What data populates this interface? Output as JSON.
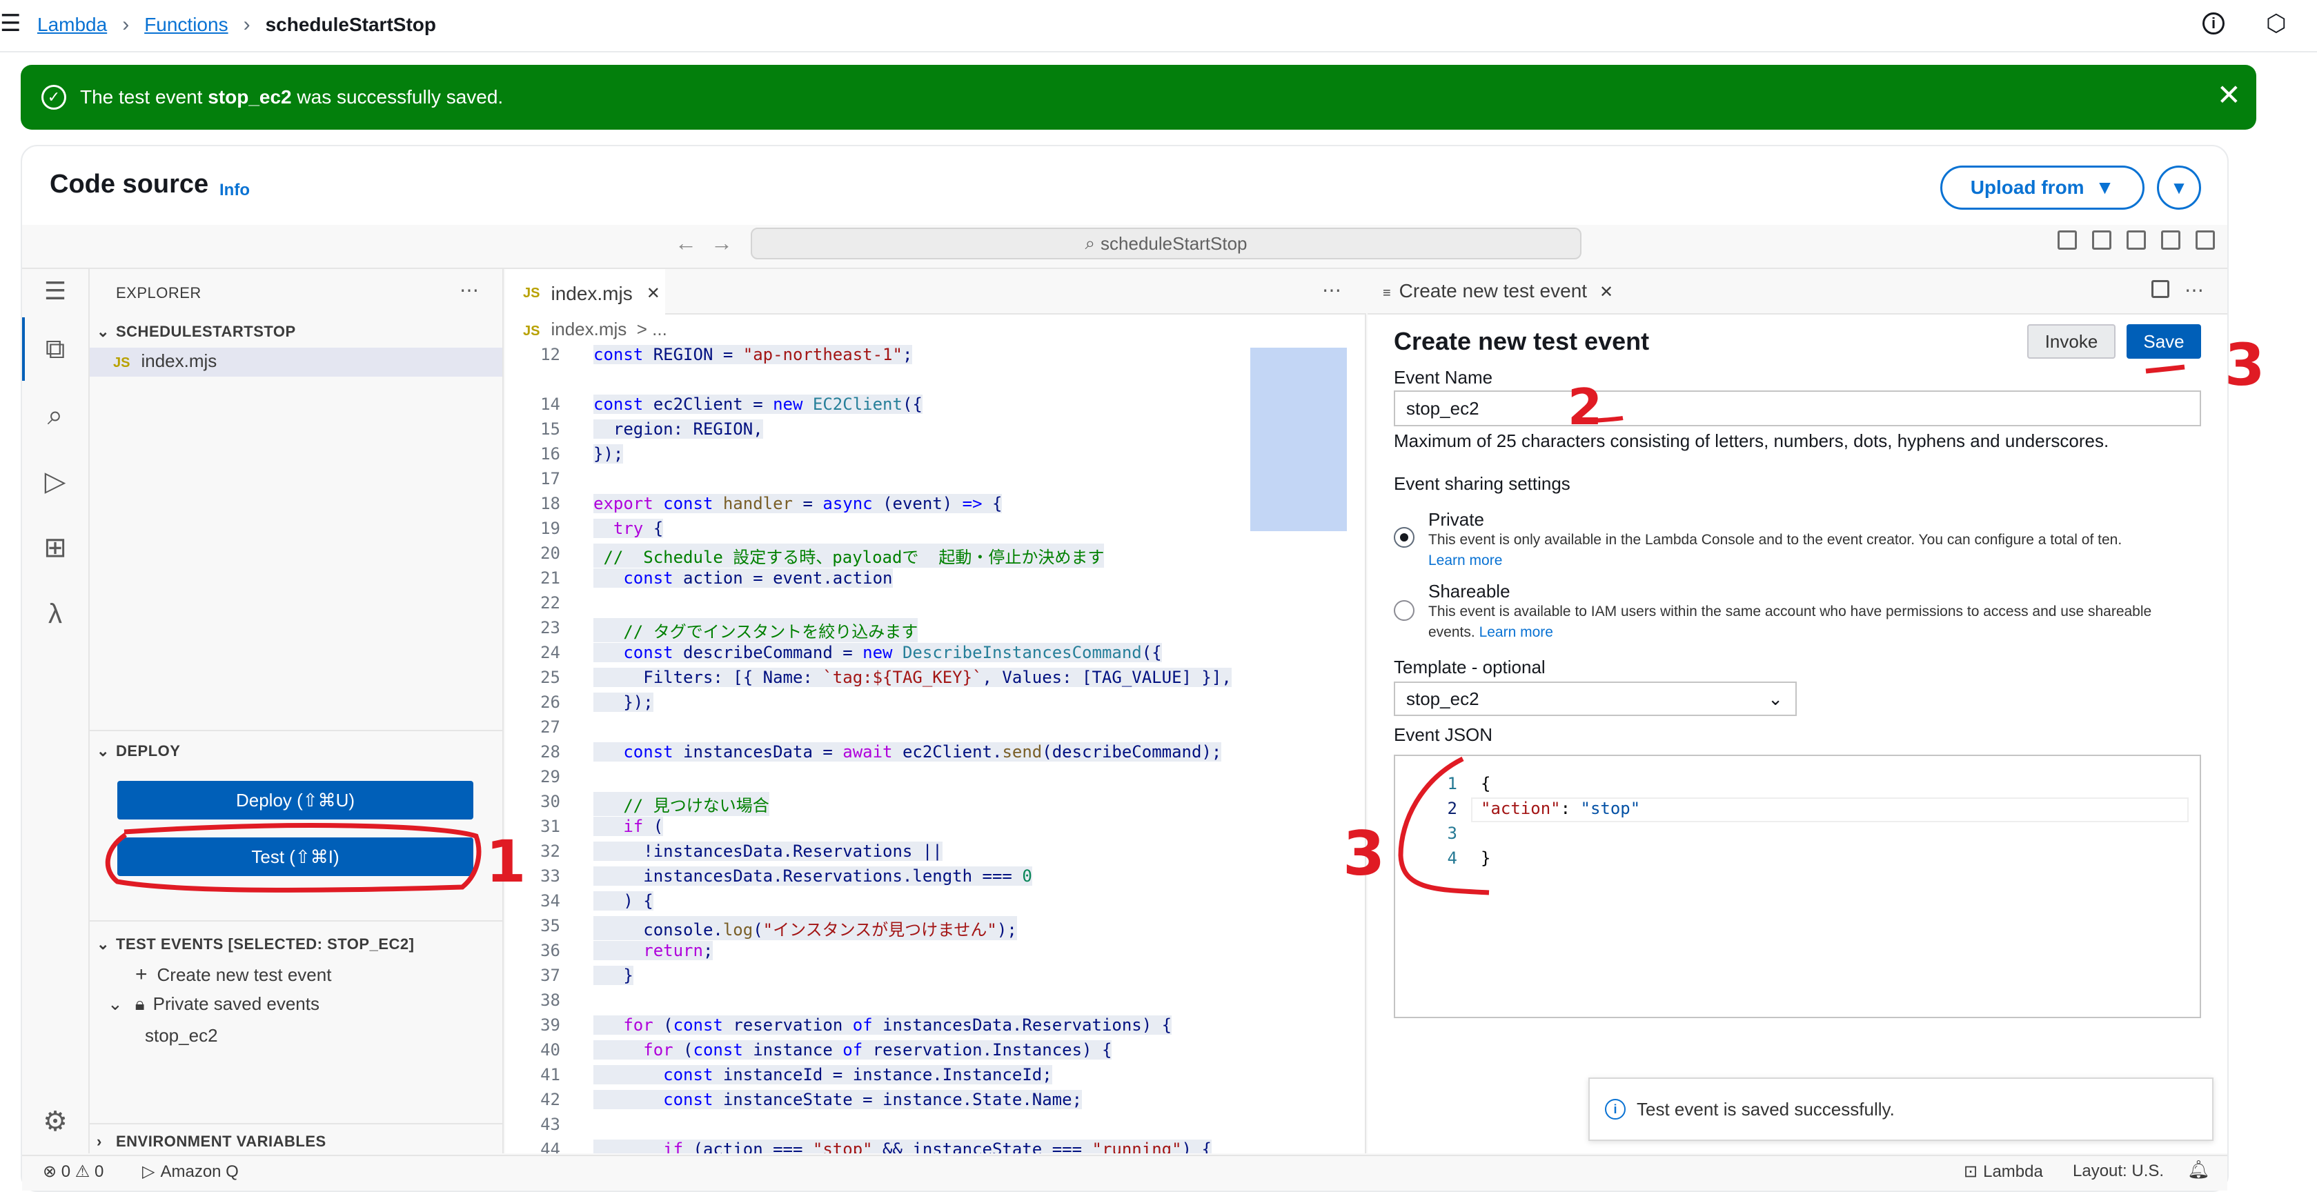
{
  "breadcrumb": {
    "items": [
      "Lambda",
      "Functions"
    ],
    "current": "scheduleStartStop"
  },
  "flash": {
    "prefix": "The test event ",
    "name": "stop_ec2",
    "suffix": " was successfully saved."
  },
  "header": {
    "title": "Code source",
    "info": "Info",
    "upload": "Upload from"
  },
  "ide": {
    "search": "scheduleStartStop"
  },
  "explorer": {
    "title": "EXPLORER",
    "folder": "SCHEDULESTARTSTOP",
    "file": "index.mjs"
  },
  "deploy": {
    "section": "DEPLOY",
    "deploy_label": "Deploy (⇧⌘U)",
    "test_label": "Test (⇧⌘I)"
  },
  "test_events": {
    "section": "TEST EVENTS [SELECTED: STOP_EC2]",
    "create": "Create new test event",
    "private": "Private saved events",
    "item": "stop_ec2"
  },
  "env": {
    "section": "ENVIRONMENT VARIABLES"
  },
  "editor": {
    "tab": "index.mjs",
    "breadcrumb": "index.mjs  > ..."
  },
  "test_pane": {
    "tab": "Create new test event",
    "title": "Create new test event",
    "invoke": "Invoke",
    "save": "Save",
    "event_name_label": "Event Name",
    "event_name_value": "stop_ec2",
    "event_name_hint": "Maximum of 25 characters consisting of letters, numbers, dots, hyphens and underscores.",
    "sharing_label": "Event sharing settings",
    "private_label": "Private",
    "private_desc": "This event is only available in the Lambda Console and to the event creator. You can configure a total of ten.",
    "learn_more": "Learn more",
    "shareable_label": "Shareable",
    "shareable_desc": "This event is available to IAM users within the same account who have permissions to access and use shareable events.",
    "template_label": "Template - optional",
    "template_value": "stop_ec2",
    "json_label": "Event JSON",
    "json_lines": [
      "{",
      "  \"action\": \"stop\"",
      "",
      "}"
    ]
  },
  "toast": "Test event is saved successfully.",
  "status": {
    "problems": "⊗ 0 ⚠ 0",
    "amazonq": "Amazon Q",
    "lambda": "Lambda",
    "layout": "Layout: U.S."
  },
  "annotations": [
    "1",
    "2",
    "3",
    "3"
  ]
}
